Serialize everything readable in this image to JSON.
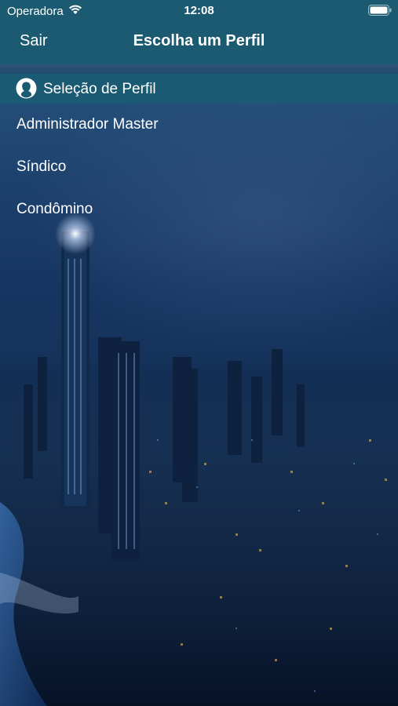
{
  "status_bar": {
    "carrier": "Operadora",
    "time": "12:08",
    "wifi_icon": "wifi-icon",
    "battery_icon": "battery-icon"
  },
  "nav": {
    "back_label": "Sair",
    "title": "Escolha um Perfil"
  },
  "section": {
    "icon": "user-silhouette-icon",
    "title": "Seleção de Perfil"
  },
  "profiles": [
    {
      "label": "Administrador Master"
    },
    {
      "label": "Síndico"
    },
    {
      "label": "Condômino"
    }
  ],
  "colors": {
    "header": "#1b5a70",
    "section_header": "#1a5a72",
    "text": "#ffffff"
  }
}
